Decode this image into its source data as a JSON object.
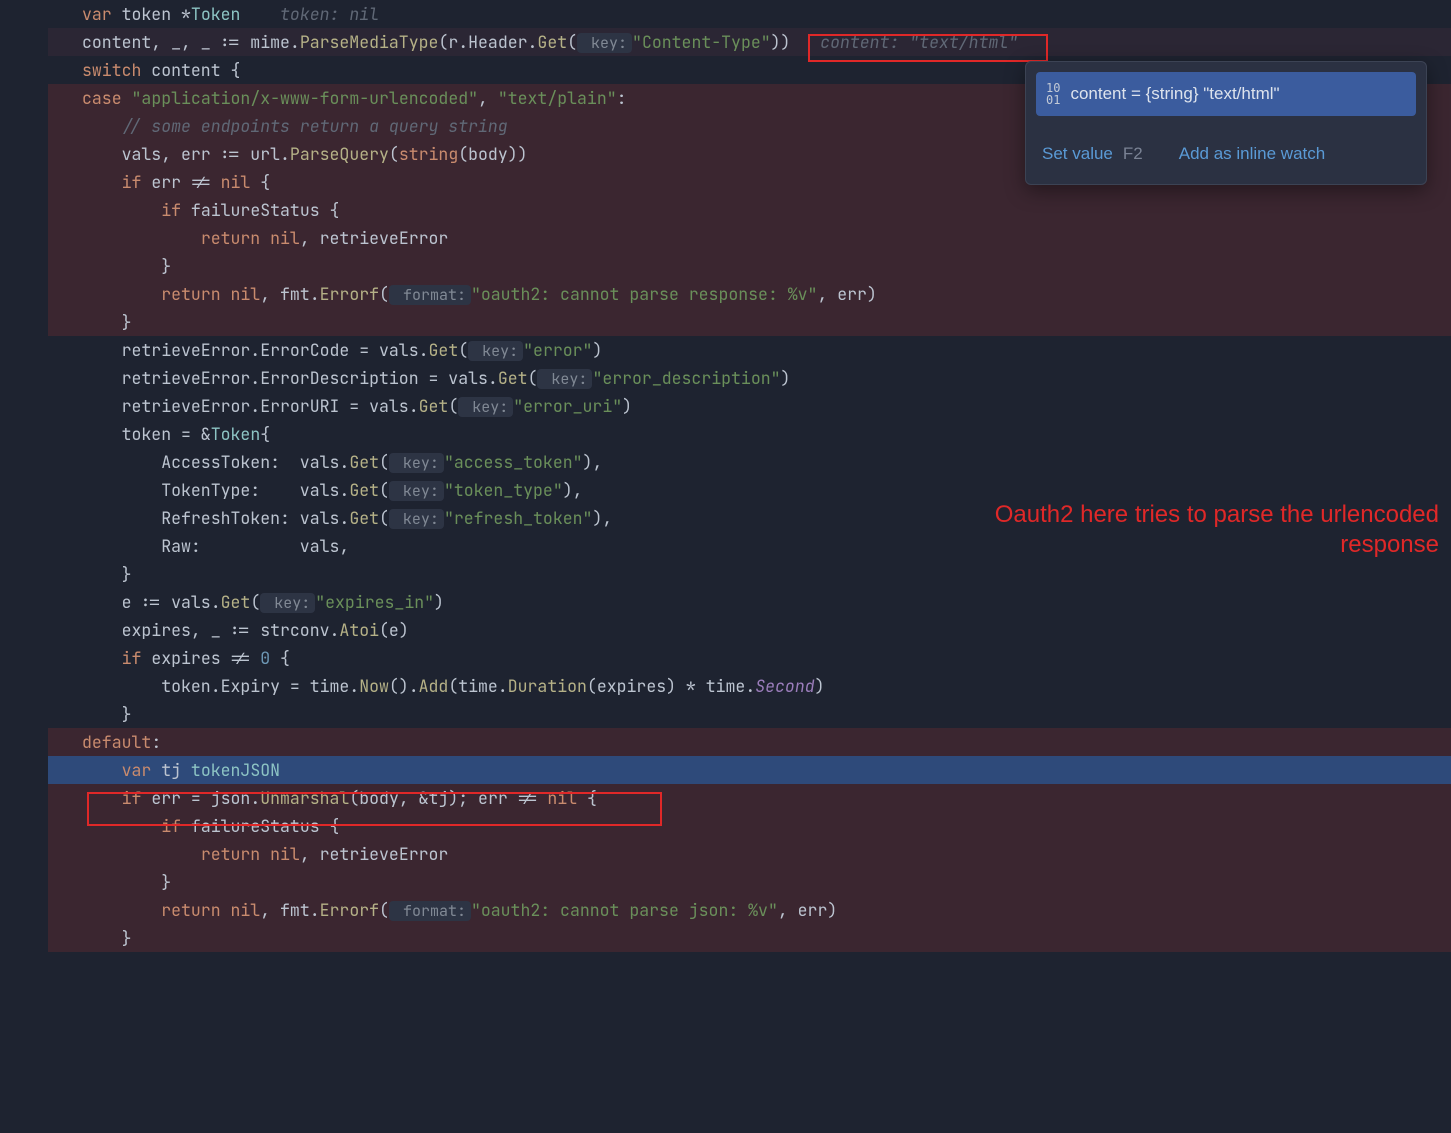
{
  "code": {
    "l1_var": "var",
    "l1_token": "token",
    "l1_star": "*",
    "l1_type": "Token",
    "l1_inlay": "token: nil",
    "l2_lhs": "content, _, _ := mime.",
    "l2_func": "ParseMediaType",
    "l2_open": "(r.Header.",
    "l2_get": "Get",
    "l2_open2": "(",
    "l2_keyhint": " key:",
    "l2_str": "\"Content-Type\"",
    "l2_close": "))",
    "l2_inlay": "content: \"text/html\"",
    "l3_switch": "switch",
    "l3_rest": " content {",
    "l4_case": "case",
    "l4_s1": "\"application/x-www-form-urlencoded\"",
    "l4_sep": ", ",
    "l4_s2": "\"text/plain\"",
    "l4_colon": ":",
    "l5_comment": "// some endpoints return a query string",
    "l6": "vals, err := url.",
    "l6_func": "ParseQuery",
    "l6_open": "(",
    "l6_string": "string",
    "l6_rest": "(body))",
    "l7_if": "if",
    "l7_rest": " err != ",
    "l7_nil": "nil",
    "l7_brace": " {",
    "l8_if": "if",
    "l8_rest": " failureStatus {",
    "l9_return": "return",
    "l9_nil": " nil",
    "l9_rest": ", retrieveError",
    "l10": "}",
    "l11_return": "return",
    "l11_nil": " nil",
    "l11_rest": ", fmt.",
    "l11_func": "Errorf",
    "l11_open": "(",
    "l11_fmthint": " format:",
    "l11_str": "\"oauth2: cannot parse response: %v\"",
    "l11_end": ", err)",
    "l12": "}",
    "l13_a": "retrieveError.ErrorCode = vals.",
    "l13_get": "Get",
    "l13_open": "(",
    "l13_hint": " key:",
    "l13_str": "\"error\"",
    "l13_close": ")",
    "l14_a": "retrieveError.ErrorDescription = vals.",
    "l14_str": "\"error_description\"",
    "l15_a": "retrieveError.ErrorURI = vals.",
    "l15_str": "\"error_uri\"",
    "l16_a": "token = &",
    "l16_type": "Token",
    "l16_brace": "{",
    "l17_field": "AccessToken:  vals.",
    "l17_str": "\"access_token\"",
    "l17_end": "),",
    "l18_field": "TokenType:    vals.",
    "l18_str": "\"token_type\"",
    "l19_field": "RefreshToken: vals.",
    "l19_str": "\"refresh_token\"",
    "l20_field": "Raw:          vals,",
    "l21": "}",
    "l22_a": "e := vals.",
    "l22_str": "\"expires_in\"",
    "l23_a": "expires, _ := strconv.",
    "l23_func": "Atoi",
    "l23_rest": "(e)",
    "l24_if": "if",
    "l24_rest": " expires != ",
    "l24_zero": "0",
    "l24_brace": " {",
    "l25_a": "token.Expiry = time.",
    "l25_now": "Now",
    "l25_b": "().",
    "l25_add": "Add",
    "l25_c": "(time.",
    "l25_dur": "Duration",
    "l25_d": "(expires) * time.",
    "l25_second": "Second",
    "l25_e": ")",
    "l26": "}",
    "l27_default": "default",
    "l27_colon": ":",
    "l28_var": "var",
    "l28_rest": " tj ",
    "l28_type": "tokenJSON",
    "l29_if": "if",
    "l29_a": " err = json.",
    "l29_func": "Unmarshal",
    "l29_b": "(body, &tj); err != ",
    "l29_nil": "nil",
    "l29_brace": " {",
    "l30_if": "if",
    "l30_rest": " failureStatus {",
    "l31_return": "return",
    "l31_nil": " nil",
    "l31_rest": ", retrieveError",
    "l32": "}",
    "l33_return": "return",
    "l33_nil": " nil",
    "l33_rest": ", fmt.",
    "l33_func": "Errorf",
    "l33_open": "(",
    "l33_hint": " format:",
    "l33_str": "\"oauth2: cannot parse json: %v\"",
    "l33_end": ", err)",
    "l34": "}"
  },
  "popup": {
    "icon": "10\n01",
    "var_line": "content = {string} \"text/html\"",
    "set_value": "Set value",
    "set_value_kbd": "F2",
    "inline_watch": "Add as inline watch"
  },
  "annotation": {
    "text_line1": "Oauth2 here tries to parse the urlencoded",
    "text_line2": "response"
  }
}
